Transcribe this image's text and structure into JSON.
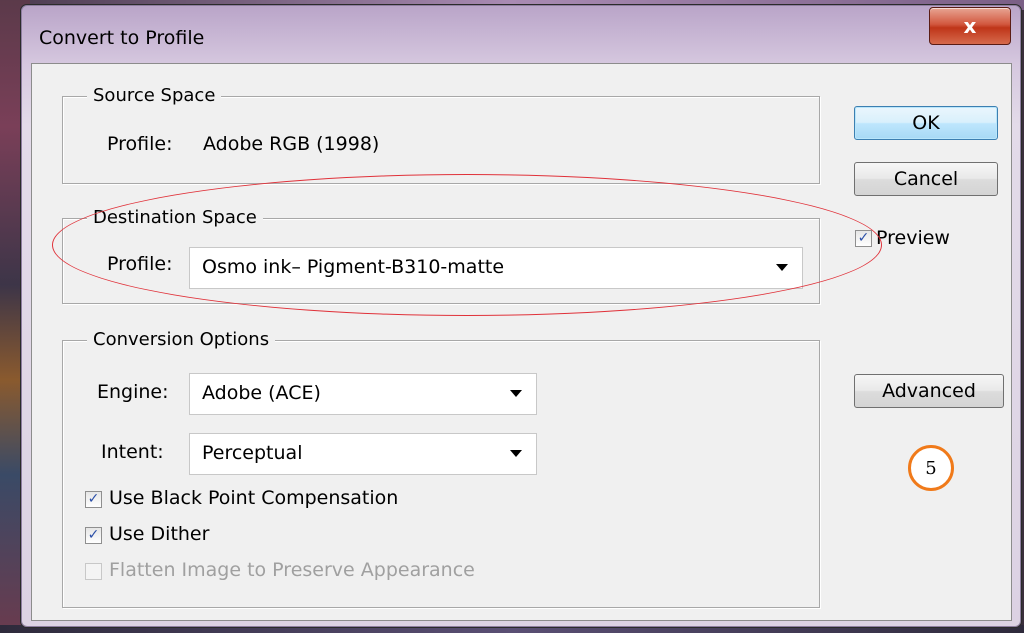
{
  "window": {
    "title": "Convert to Profile",
    "close_glyph": "x"
  },
  "source_space": {
    "legend": "Source Space",
    "profile_label": "Profile:",
    "profile_value": "Adobe RGB (1998)"
  },
  "destination_space": {
    "legend": "Destination Space",
    "profile_label": "Profile:",
    "profile_value": "Osmo ink– Pigment-B310-matte"
  },
  "conversion_options": {
    "legend": "Conversion Options",
    "engine_label": "Engine:",
    "engine_value": "Adobe (ACE)",
    "intent_label": "Intent:",
    "intent_value": "Perceptual",
    "black_point_label": "Use Black Point Compensation",
    "black_point_checked": true,
    "dither_label": "Use Dither",
    "dither_checked": true,
    "flatten_label": "Flatten Image to Preserve Appearance",
    "flatten_checked": false,
    "flatten_disabled": true
  },
  "buttons": {
    "ok": "OK",
    "cancel": "Cancel",
    "advanced": "Advanced"
  },
  "preview": {
    "label": "Preview",
    "checked": true
  },
  "annotation": {
    "step_number": "5",
    "ellipse_color": "#e0323a",
    "badge_color": "#f07a1a"
  },
  "check_glyph": "✓"
}
